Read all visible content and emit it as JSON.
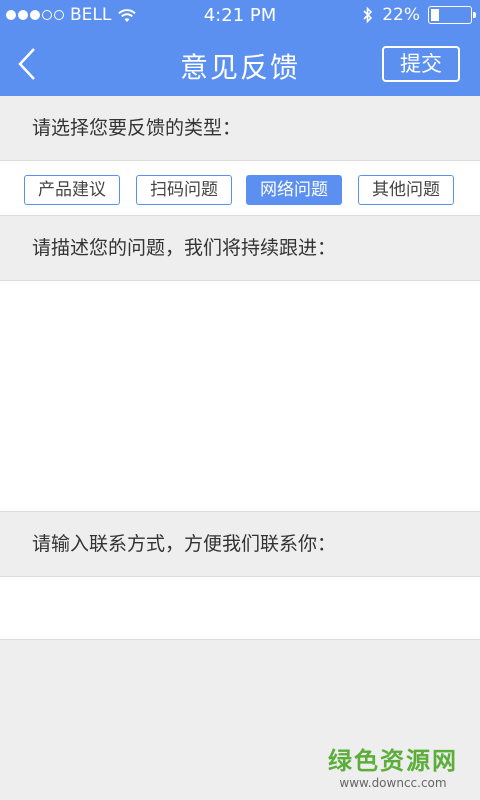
{
  "status_bar": {
    "carrier": "BELL",
    "time": "4:21 PM",
    "battery_text": "22%",
    "battery_level": 0.22
  },
  "nav": {
    "title": "意见反馈",
    "submit_label": "提交"
  },
  "feedback": {
    "type_prompt": "请选择您要反馈的类型：",
    "types": [
      "产品建议",
      "扫码问题",
      "网络问题",
      "其他问题"
    ],
    "selected_type": "网络问题",
    "description_prompt": "请描述您的问题，我们将持续跟进：",
    "description_value": "",
    "contact_prompt": "请输入联系方式，方便我们联系你：",
    "contact_value": ""
  },
  "watermark": {
    "main": "绿色资源网",
    "sub": "www.downcc.com"
  },
  "colors": {
    "accent": "#5b8ff0",
    "background": "#eeeeee",
    "watermark_green": "#5cae3a"
  }
}
